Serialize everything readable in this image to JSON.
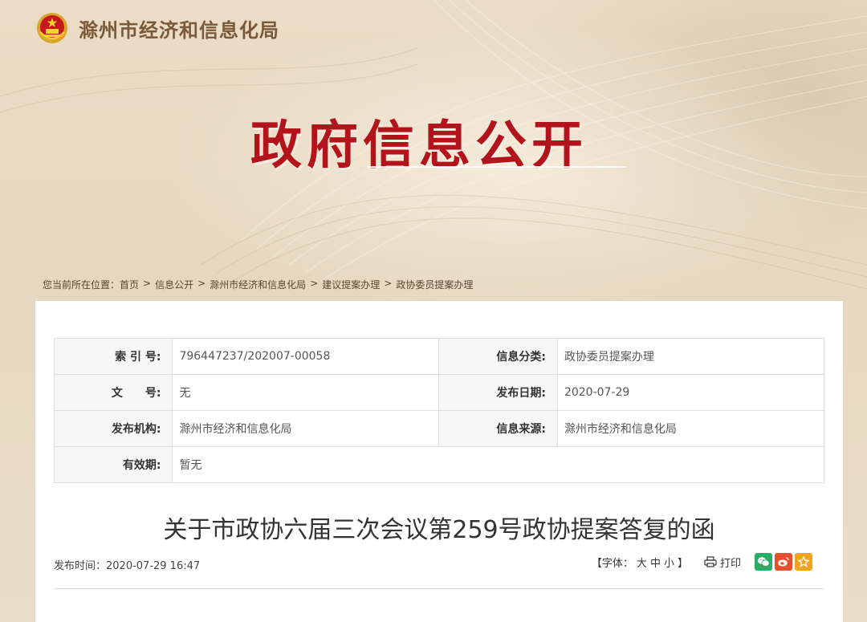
{
  "header": {
    "site_title": "滁州市经济和信息化局",
    "hero_title": "政府信息公开"
  },
  "breadcrumb": {
    "prefix": "您当前所在位置：",
    "items": [
      "首页",
      "信息公开",
      "滁州市经济和信息化局",
      "建议提案办理",
      "政协委员提案办理"
    ],
    "separator": ">"
  },
  "meta": {
    "rows": [
      [
        {
          "k": "索 引 号:",
          "v": "796447237/202007-00058"
        },
        {
          "k": "信息分类:",
          "v": "政协委员提案办理"
        }
      ],
      [
        {
          "k": "文　　号:",
          "v": "无"
        },
        {
          "k": "发布日期:",
          "v": "2020-07-29"
        }
      ],
      [
        {
          "k": "发布机构:",
          "v": "滁州市经济和信息化局"
        },
        {
          "k": "信息来源:",
          "v": "滁州市经济和信息化局"
        }
      ],
      [
        {
          "k": "有效期:",
          "v": "暂无"
        }
      ]
    ]
  },
  "article": {
    "title": "关于市政协六届三次会议第259号政协提案答复的函",
    "pubtime": "发布时间：2020-07-29 16:47"
  },
  "tools": {
    "font_open": "【字体：",
    "font_large": "大",
    "font_medium": "中",
    "font_small": "小",
    "font_close": "】",
    "print_label": "打印",
    "share_icons": [
      "wechat-icon",
      "weibo-icon",
      "favorite-icon"
    ]
  },
  "colors": {
    "hero_red": "#b3141c",
    "site_title": "#7a5a3a",
    "wechat": "#2aae67",
    "weibo": "#e6502d",
    "favorite": "#f2a41b"
  }
}
